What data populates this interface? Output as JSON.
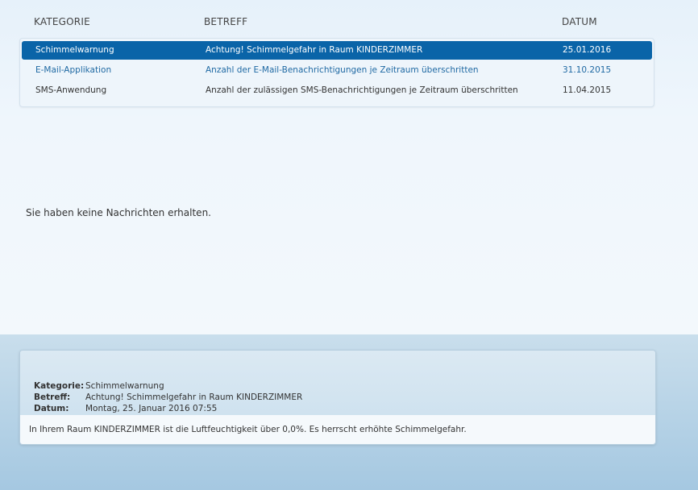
{
  "columns": {
    "category": "KATEGORIE",
    "subject": "BETREFF",
    "date": "DATUM"
  },
  "messages": [
    {
      "category": "Schimmelwarnung",
      "subject": "Achtung! Schimmelgefahr in Raum KINDERZIMMER",
      "date": "25.01.2016",
      "state": "selected"
    },
    {
      "category": "E-Mail-Applikation",
      "subject": "Anzahl der E-Mail-Benachrichtigungen je Zeitraum überschritten",
      "date": "31.10.2015",
      "state": "link"
    },
    {
      "category": "SMS-Anwendung",
      "subject": "Anzahl der zulässigen SMS-Benachrichtigungen je Zeitraum überschritten",
      "date": "11.04.2015",
      "state": "plain"
    }
  ],
  "empty_message": "Sie haben keine Nachrichten erhalten.",
  "detail": {
    "category_label": "Kategorie:",
    "category_value": "Schimmelwarnung",
    "subject_label": "Betreff:",
    "subject_value": "Achtung! Schimmelgefahr in Raum KINDERZIMMER",
    "date_label": "Datum:",
    "date_value": "Montag, 25. Januar 2016 07:55",
    "body": "In Ihrem Raum KINDERZIMMER ist die Luftfeuchtigkeit über 0,0%. Es herrscht erhöhte Schimmelgefahr."
  },
  "colors": {
    "selected_row": "#0a64a8",
    "link_text": "#1f69a3"
  }
}
